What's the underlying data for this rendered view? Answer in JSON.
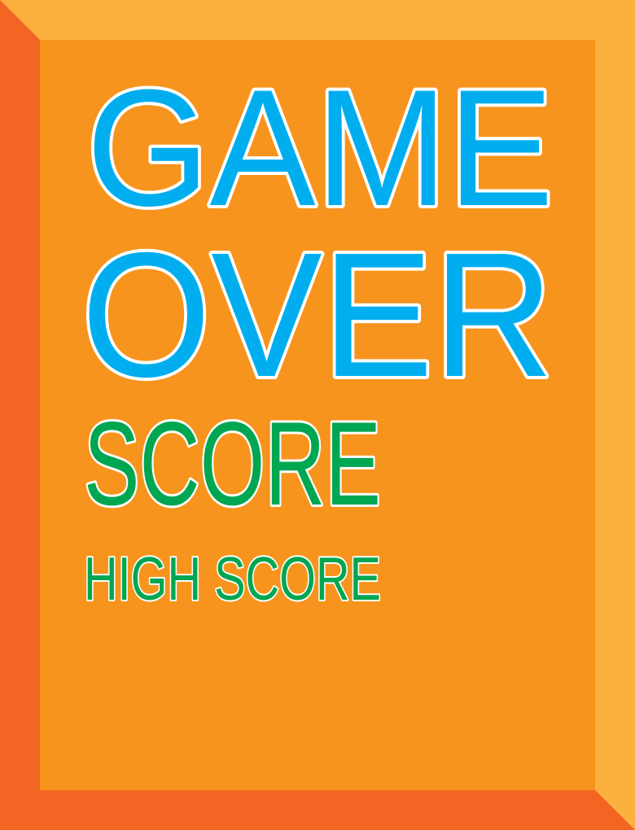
{
  "title": "GAME",
  "title2": "OVER",
  "score_label": "SCORE",
  "high_score_label": "HIGH SCORE",
  "colors": {
    "panel": "#F7941D",
    "bevel_light": "#FBB040",
    "bevel_dark": "#F26522",
    "title": "#00AEEF",
    "score": "#00A651",
    "outline": "#FFFFFF"
  }
}
